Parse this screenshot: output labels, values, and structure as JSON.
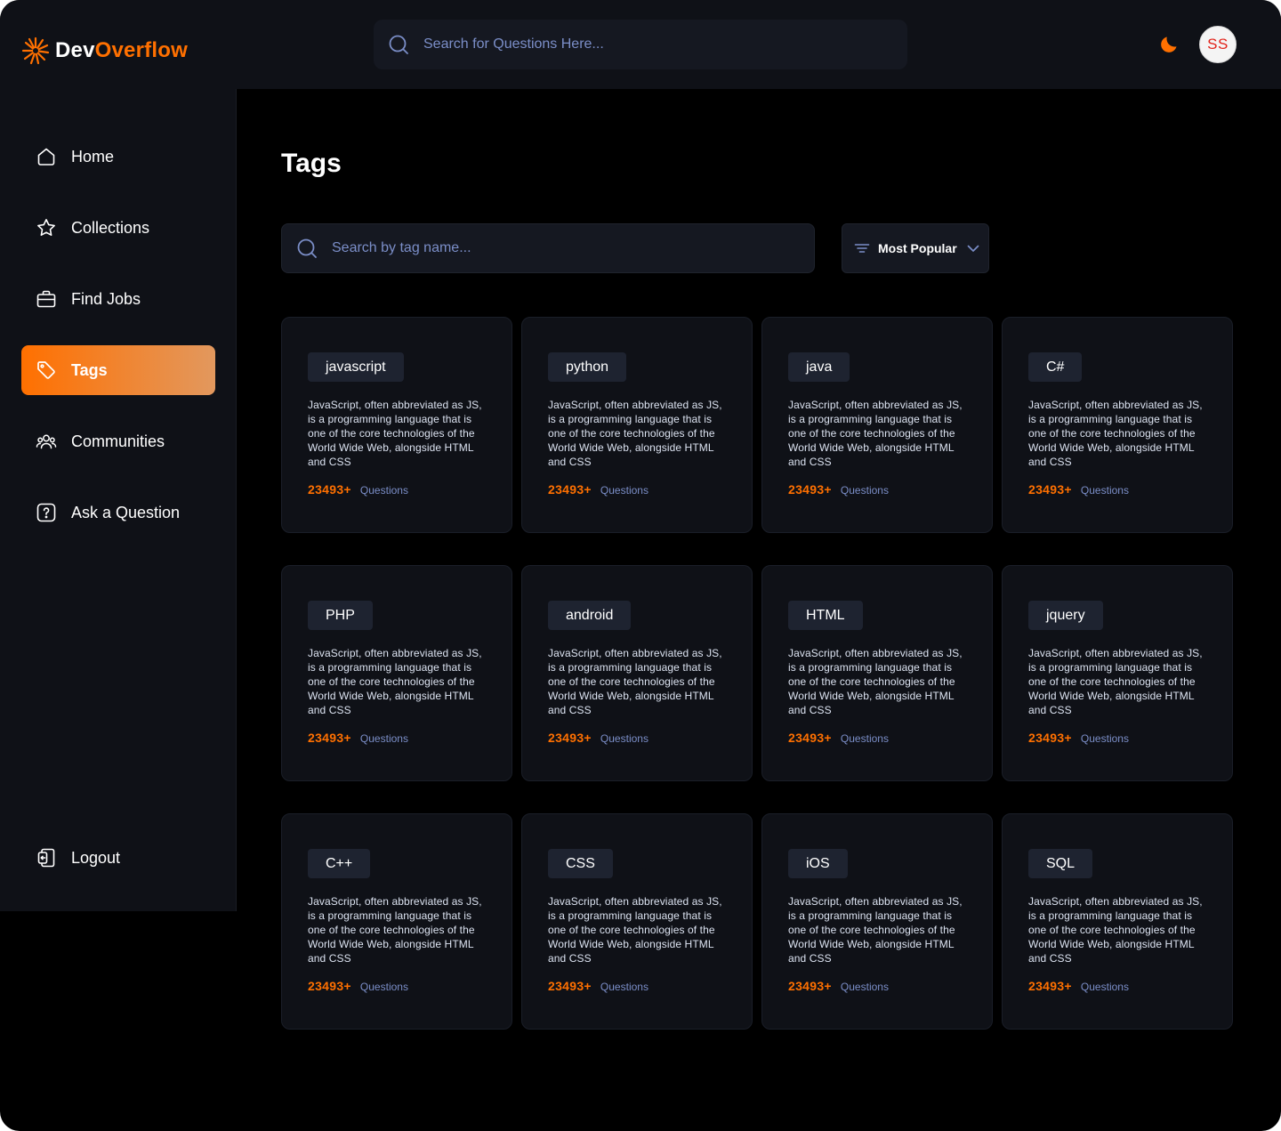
{
  "brand": {
    "name_part1": "Dev",
    "name_part2": "Overflow"
  },
  "header": {
    "search_placeholder": "Search for Questions Here...",
    "avatar_initials": "SS"
  },
  "sidebar": {
    "items": [
      {
        "label": "Home",
        "icon": "home-icon"
      },
      {
        "label": "Collections",
        "icon": "star-icon"
      },
      {
        "label": "Find Jobs",
        "icon": "briefcase-icon"
      },
      {
        "label": "Tags",
        "icon": "tag-icon",
        "active": true
      },
      {
        "label": "Communities",
        "icon": "users-icon"
      },
      {
        "label": "Ask a Question",
        "icon": "question-icon"
      }
    ],
    "logout_label": "Logout"
  },
  "main": {
    "title": "Tags",
    "search_placeholder": "Search by tag name...",
    "filter_selected": "Most Popular"
  },
  "tags": [
    {
      "name": "javascript",
      "description": "JavaScript, often abbreviated as JS, is a programming language that is one of the core technologies of the World Wide Web, alongside HTML and CSS",
      "count": "23493+",
      "count_label": "Questions"
    },
    {
      "name": "python",
      "description": "JavaScript, often abbreviated as JS, is a programming language that is one of the core technologies of the World Wide Web, alongside HTML and CSS",
      "count": "23493+",
      "count_label": "Questions"
    },
    {
      "name": "java",
      "description": "JavaScript, often abbreviated as JS, is a programming language that is one of the core technologies of the World Wide Web, alongside HTML and CSS",
      "count": "23493+",
      "count_label": "Questions"
    },
    {
      "name": "C#",
      "description": "JavaScript, often abbreviated as JS, is a programming language that is one of the core technologies of the World Wide Web, alongside HTML and CSS",
      "count": "23493+",
      "count_label": "Questions"
    },
    {
      "name": "PHP",
      "description": "JavaScript, often abbreviated as JS, is a programming language that is one of the core technologies of the World Wide Web, alongside HTML and CSS",
      "count": "23493+",
      "count_label": "Questions"
    },
    {
      "name": "android",
      "description": "JavaScript, often abbreviated as JS, is a programming language that is one of the core technologies of the World Wide Web, alongside HTML and CSS",
      "count": "23493+",
      "count_label": "Questions"
    },
    {
      "name": "HTML",
      "description": "JavaScript, often abbreviated as JS, is a programming language that is one of the core technologies of the World Wide Web, alongside HTML and CSS",
      "count": "23493+",
      "count_label": "Questions"
    },
    {
      "name": "jquery",
      "description": "JavaScript, often abbreviated as JS, is a programming language that is one of the core technologies of the World Wide Web, alongside HTML and CSS",
      "count": "23493+",
      "count_label": "Questions"
    },
    {
      "name": "C++",
      "description": "JavaScript, often abbreviated as JS, is a programming language that is one of the core technologies of the World Wide Web, alongside HTML and CSS",
      "count": "23493+",
      "count_label": "Questions"
    },
    {
      "name": "CSS",
      "description": "JavaScript, often abbreviated as JS, is a programming language that is one of the core technologies of the World Wide Web, alongside HTML and CSS",
      "count": "23493+",
      "count_label": "Questions"
    },
    {
      "name": "iOS",
      "description": "JavaScript, often abbreviated as JS, is a programming language that is one of the core technologies of the World Wide Web, alongside HTML and CSS",
      "count": "23493+",
      "count_label": "Questions"
    },
    {
      "name": "SQL",
      "description": "JavaScript, often abbreviated as JS, is a programming language that is one of the core technologies of the World Wide Web, alongside HTML and CSS",
      "count": "23493+",
      "count_label": "Questions"
    }
  ],
  "colors": {
    "accent": "#ff7000",
    "accent_gradient_end": "#e2985e",
    "background": "#000000",
    "panel": "#0f1117",
    "muted_blue": "#7b8ec8"
  }
}
